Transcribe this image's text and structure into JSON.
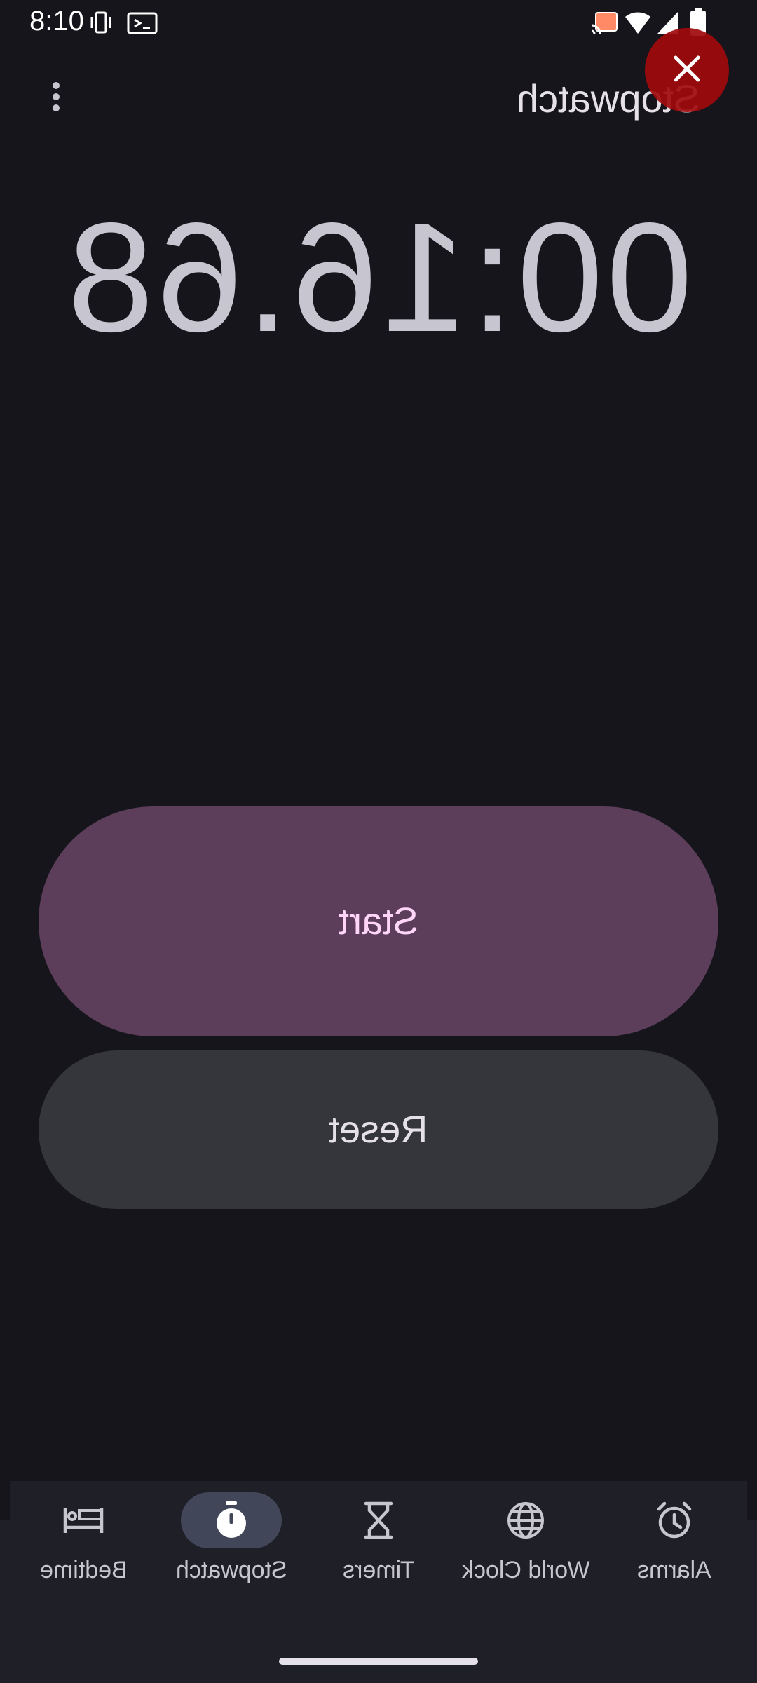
{
  "status_bar": {
    "time": "8:10",
    "icons": [
      "vibrate-icon",
      "screen-cast-icon",
      "cast-icon",
      "wifi-icon",
      "signal-icon",
      "battery-icon"
    ]
  },
  "toolbar": {
    "title": "Stopwatch",
    "more_icon": "more-vert-icon",
    "close_icon": "close-icon"
  },
  "stopwatch": {
    "elapsed": "00:16.68"
  },
  "buttons": {
    "start_label": "Start",
    "reset_label": "Reset"
  },
  "bottom_nav": {
    "items": [
      {
        "label": "Alarms",
        "icon": "alarm-icon"
      },
      {
        "label": "World Clock",
        "icon": "globe-icon"
      },
      {
        "label": "Timers",
        "icon": "hourglass-icon"
      },
      {
        "label": "Stopwatch",
        "icon": "stopwatch-icon"
      },
      {
        "label": "Bedtime",
        "icon": "bed-icon"
      }
    ],
    "active_label": "Stopwatch"
  },
  "colors": {
    "background": "#15151b",
    "start_button": "#5c3e5b",
    "reset_button": "#35363c",
    "close_fab": "#a00a0c",
    "active_nav_indicator": "#414659"
  }
}
